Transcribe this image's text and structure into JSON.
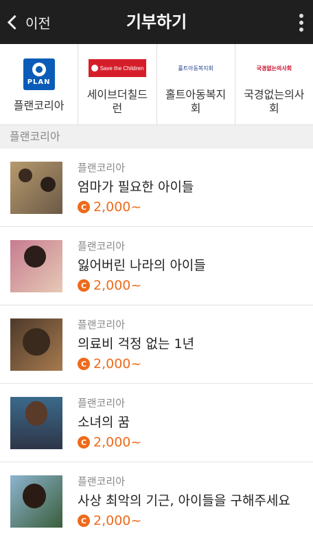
{
  "header": {
    "back_label": "이전",
    "title": "기부하기"
  },
  "orgs": [
    {
      "name": "플랜코리아",
      "logo_icon": "plan-logo-icon",
      "logo_text": "PLAN"
    },
    {
      "name": "세이브더칠드런",
      "logo_icon": "save-the-children-logo-icon",
      "logo_text": "Save the Children"
    },
    {
      "name": "홀트아동복지회",
      "logo_icon": "holt-logo-icon",
      "logo_text": "홀트아동복지회"
    },
    {
      "name": "국경없는의사회",
      "logo_icon": "msf-logo-icon",
      "logo_text": "국경없는의사회"
    }
  ],
  "section": {
    "title": "플랜코리아"
  },
  "items": [
    {
      "org": "플랜코리아",
      "title": "엄마가 필요한 아이들",
      "price": "2,000~",
      "coin_label": "C"
    },
    {
      "org": "플랜코리아",
      "title": "잃어버린 나라의 아이들",
      "price": "2,000~",
      "coin_label": "C"
    },
    {
      "org": "플랜코리아",
      "title": "의료비 걱정 없는 1년",
      "price": "2,000~",
      "coin_label": "C"
    },
    {
      "org": "플랜코리아",
      "title": "소녀의 꿈",
      "price": "2,000~",
      "coin_label": "C"
    },
    {
      "org": "플랜코리아",
      "title": "사상 최악의 기근, 아이들을 구해주세요",
      "price": "2,000~",
      "coin_label": "C"
    }
  ],
  "colors": {
    "accent": "#ee6a1b",
    "header_bg": "#1f1f1f"
  }
}
